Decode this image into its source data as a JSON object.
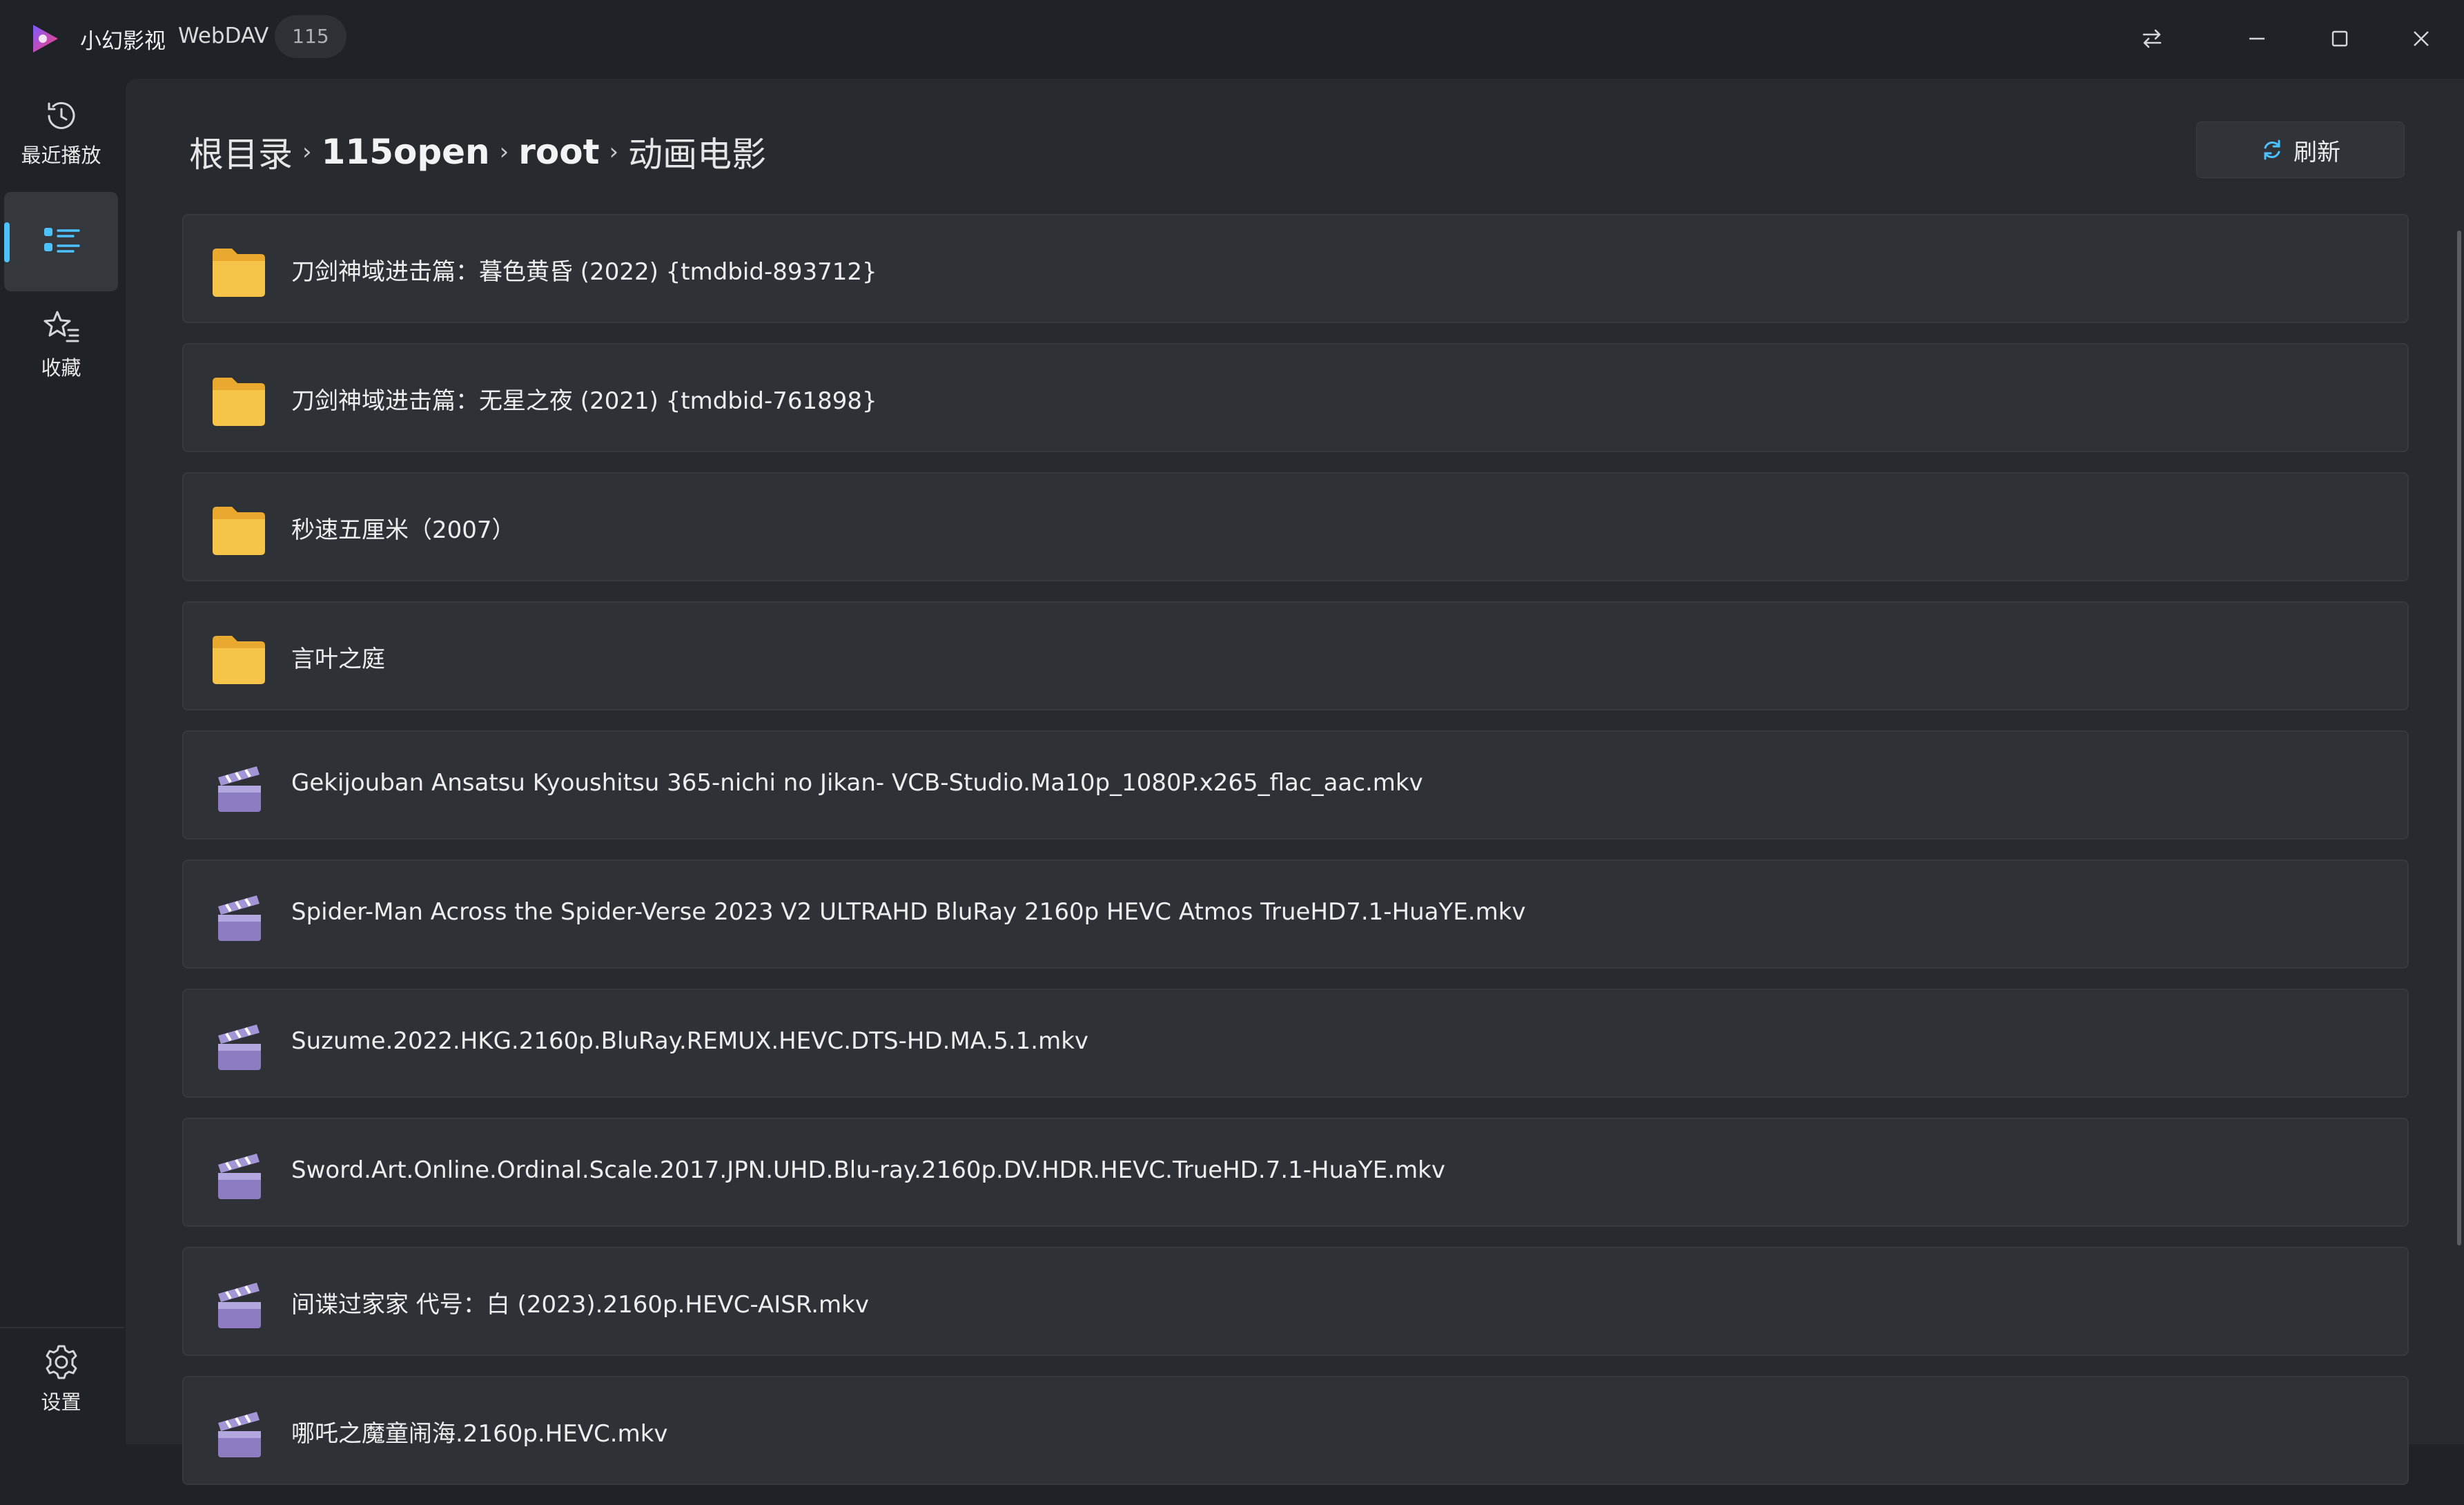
{
  "titlebar": {
    "app_name": "小幻影视",
    "source": "WebDAV",
    "badge": "115"
  },
  "sidebar": {
    "items": [
      {
        "label": "最近播放",
        "icon": "history-icon"
      },
      {
        "label": "",
        "icon": "file-list-icon",
        "active": true
      },
      {
        "label": "收藏",
        "icon": "star-list-icon"
      }
    ],
    "settings_label": "设置"
  },
  "breadcrumb": [
    "根目录",
    "115open",
    "root",
    "动画电影"
  ],
  "toolbar": {
    "refresh_label": "刷新"
  },
  "files": [
    {
      "type": "folder",
      "name": "刀剑神域进击篇：暮色黄昏 (2022) {tmdbid-893712}"
    },
    {
      "type": "folder",
      "name": "刀剑神域进击篇：无星之夜 (2021) {tmdbid-761898}"
    },
    {
      "type": "folder",
      "name": "秒速五厘米（2007）"
    },
    {
      "type": "folder",
      "name": "言叶之庭"
    },
    {
      "type": "video",
      "name": "Gekijouban Ansatsu Kyoushitsu 365-nichi no Jikan- VCB-Studio.Ma10p_1080P.x265_flac_aac.mkv"
    },
    {
      "type": "video",
      "name": "Spider-Man Across the Spider-Verse 2023 V2 ULTRAHD BluRay 2160p HEVC Atmos TrueHD7.1-HuaYE.mkv"
    },
    {
      "type": "video",
      "name": "Suzume.2022.HKG.2160p.BluRay.REMUX.HEVC.DTS-HD.MA.5.1.mkv"
    },
    {
      "type": "video",
      "name": "Sword.Art.Online.Ordinal.Scale.2017.JPN.UHD.Blu-ray.2160p.DV.HDR.HEVC.TrueHD.7.1-HuaYE.mkv"
    },
    {
      "type": "video",
      "name": "间谍过家家 代号：白 (2023).2160p.HEVC-AISR.mkv"
    },
    {
      "type": "video",
      "name": "哪吒之魔童闹海.2160p.HEVC.mkv"
    }
  ],
  "colors": {
    "accent": "#4cc2ff",
    "folder": "#f7c44a",
    "video": "#8e7cc3"
  }
}
